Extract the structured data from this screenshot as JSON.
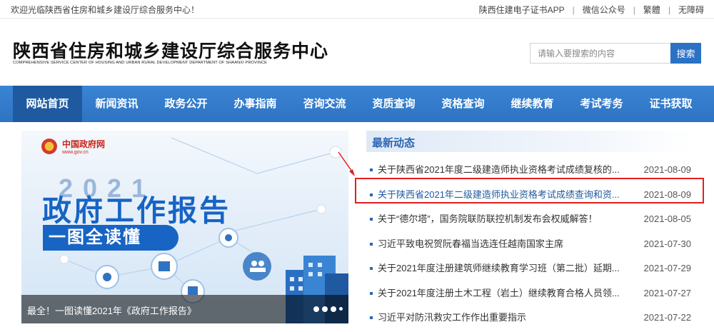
{
  "topbar": {
    "welcome": "欢迎光临陕西省住房和城乡建设厅综合服务中心！",
    "links": [
      "陕西住建电子证书APP",
      "微信公众号",
      "繁體",
      "无障碍"
    ],
    "separator": "|"
  },
  "header": {
    "title": "陕西省住房和城乡建设厅综合服务中心",
    "subtitle": "COMPREHENSIVE SERVICE CENTER OF HOUSING AND URBAN RURAL DEVELOPMENT DEPARTMENT OF SHAANXI PROVINCE",
    "search": {
      "placeholder": "请输入要搜索的内容",
      "button": "搜索"
    }
  },
  "nav": {
    "items": [
      "网站首页",
      "新闻资讯",
      "政务公开",
      "办事指南",
      "咨询交流",
      "资质查询",
      "资格查询",
      "继续教育",
      "考试考务",
      "证书获取"
    ],
    "active_index": 0
  },
  "banner": {
    "logo_name": "中国政府网",
    "logo_url": "www.gov.cn",
    "year": "2021",
    "headline": "政府工作报告",
    "tagline": "一图全读懂",
    "caption": "最全！一图读懂2021年《政府工作报告》",
    "slide_count": 4
  },
  "news": {
    "heading": "最新动态",
    "items": [
      {
        "title": "关于陕西省2021年度二级建造师执业资格考试成绩复核的...",
        "date": "2021-08-09"
      },
      {
        "title": "关于陕西省2021年二级建造师执业资格考试成绩查询和资...",
        "date": "2021-08-09"
      },
      {
        "title": "关于“德尔塔”，国务院联防联控机制发布会权威解答！",
        "date": "2021-08-05"
      },
      {
        "title": "习近平致电祝贺阮春福当选连任越南国家主席",
        "date": "2021-07-30"
      },
      {
        "title": "关于2021年度注册建筑师继续教育学习班（第二批）延期...",
        "date": "2021-07-29"
      },
      {
        "title": "关于2021年度注册土木工程（岩土）继续教育合格人员领...",
        "date": "2021-07-27"
      },
      {
        "title": "习近平对防汛救灾工作作出重要指示",
        "date": "2021-07-22"
      }
    ],
    "highlighted_index": 1
  },
  "colors": {
    "nav_bg": "#2f73c2",
    "nav_active": "#1f5aa0",
    "accent_blue": "#2a66b2",
    "highlight_box": "#e31f1f",
    "search_button": "#2b72c5"
  }
}
